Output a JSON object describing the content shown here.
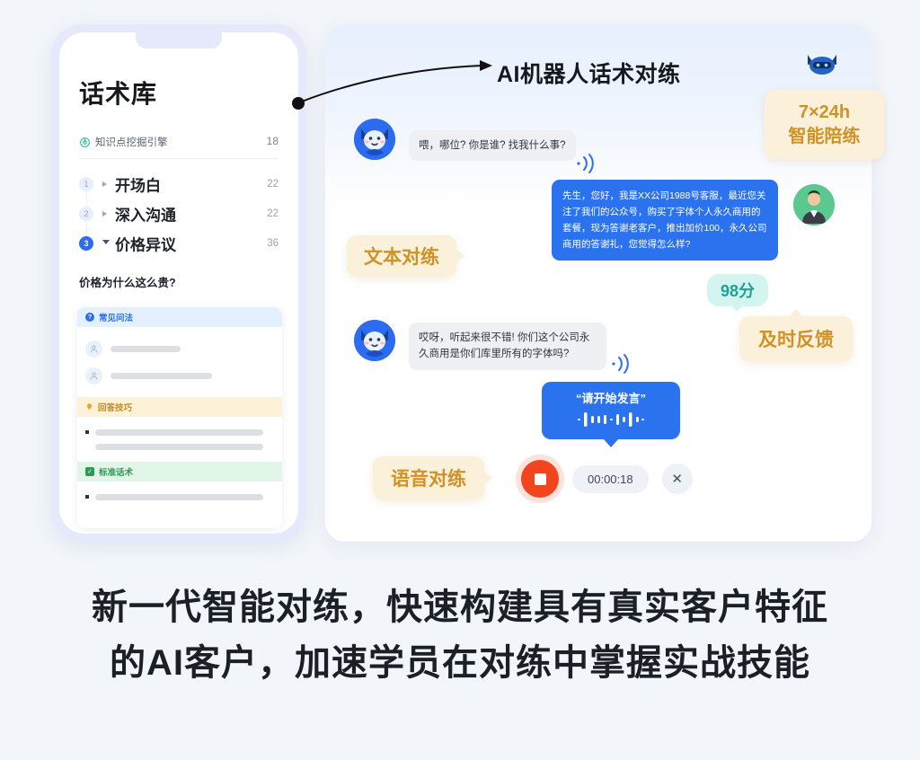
{
  "phone": {
    "title": "话术库",
    "engine_icon": "radar-icon",
    "engine_label": "知识点挖掘引擎",
    "engine_count": "18",
    "toc": [
      {
        "num": "1",
        "label": "开场白",
        "count": "22",
        "expanded": false
      },
      {
        "num": "2",
        "label": "深入沟通",
        "count": "22",
        "expanded": false
      },
      {
        "num": "3",
        "label": "价格异议",
        "count": "36",
        "expanded": true
      }
    ],
    "question_title": "价格为什么这么贵?",
    "card": {
      "sections": [
        {
          "icon": "question-mark-icon",
          "label": "常见问法",
          "style": "blue"
        },
        {
          "icon": "lightbulb-icon",
          "label": "回答技巧",
          "style": "amber"
        },
        {
          "icon": "check-square-icon",
          "label": "标准话术",
          "style": "green"
        }
      ]
    }
  },
  "panel": {
    "title": "AI机器人话术对练",
    "robot_icon": "robot-head-icon",
    "arrow_icon": "curved-arrow-icon",
    "badge_7x24": {
      "line1": "7×24h",
      "line2": "智能陪练"
    },
    "callout_text": "文本对练",
    "callout_voice": "语音对练",
    "callout_feedback": "及时反馈",
    "score": "98分",
    "chat": [
      {
        "side": "bot",
        "avatar": "robot-avatar",
        "text": "喂，哪位? 你是谁? 找我什么事?",
        "sound_icon": "sound-wave-icon"
      },
      {
        "side": "user",
        "avatar": "person-avatar",
        "text": "先生，您好，我是XX公司1988号客服，最近您关注了我们的公众号，购买了字体个人永久商用的套餐，现为答谢老客户，推出加价100，永久公司商用的答谢礼，您觉得怎么样?"
      },
      {
        "side": "bot",
        "avatar": "robot-avatar",
        "text": "哎呀，听起来很不错! 你们这个公司永久商用是你们库里所有的字体吗?",
        "sound_icon": "sound-wave-icon"
      }
    ],
    "speak_prompt": "“请开始发言”",
    "waveform_icon": "audio-waveform-icon",
    "record_button_icon": "stop-record-icon",
    "timer": "00:00:18",
    "close_icon": "close-icon"
  },
  "caption": {
    "line1": "新一代智能对练，快速构建具有真实客户特征",
    "line2": "的AI客户，加速学员在对练中掌握实战技能"
  },
  "colors": {
    "background": "#f2f5f9",
    "accent_blue": "#2b6cf0",
    "bubble_blue": "#2b72ee",
    "callout_bg": "#fbf0d9",
    "callout_text": "#d09226",
    "score_bg": "#d4f4ef",
    "score_text": "#1ea390",
    "record_red": "#f0451f",
    "avatar_green": "#5bc98f"
  }
}
